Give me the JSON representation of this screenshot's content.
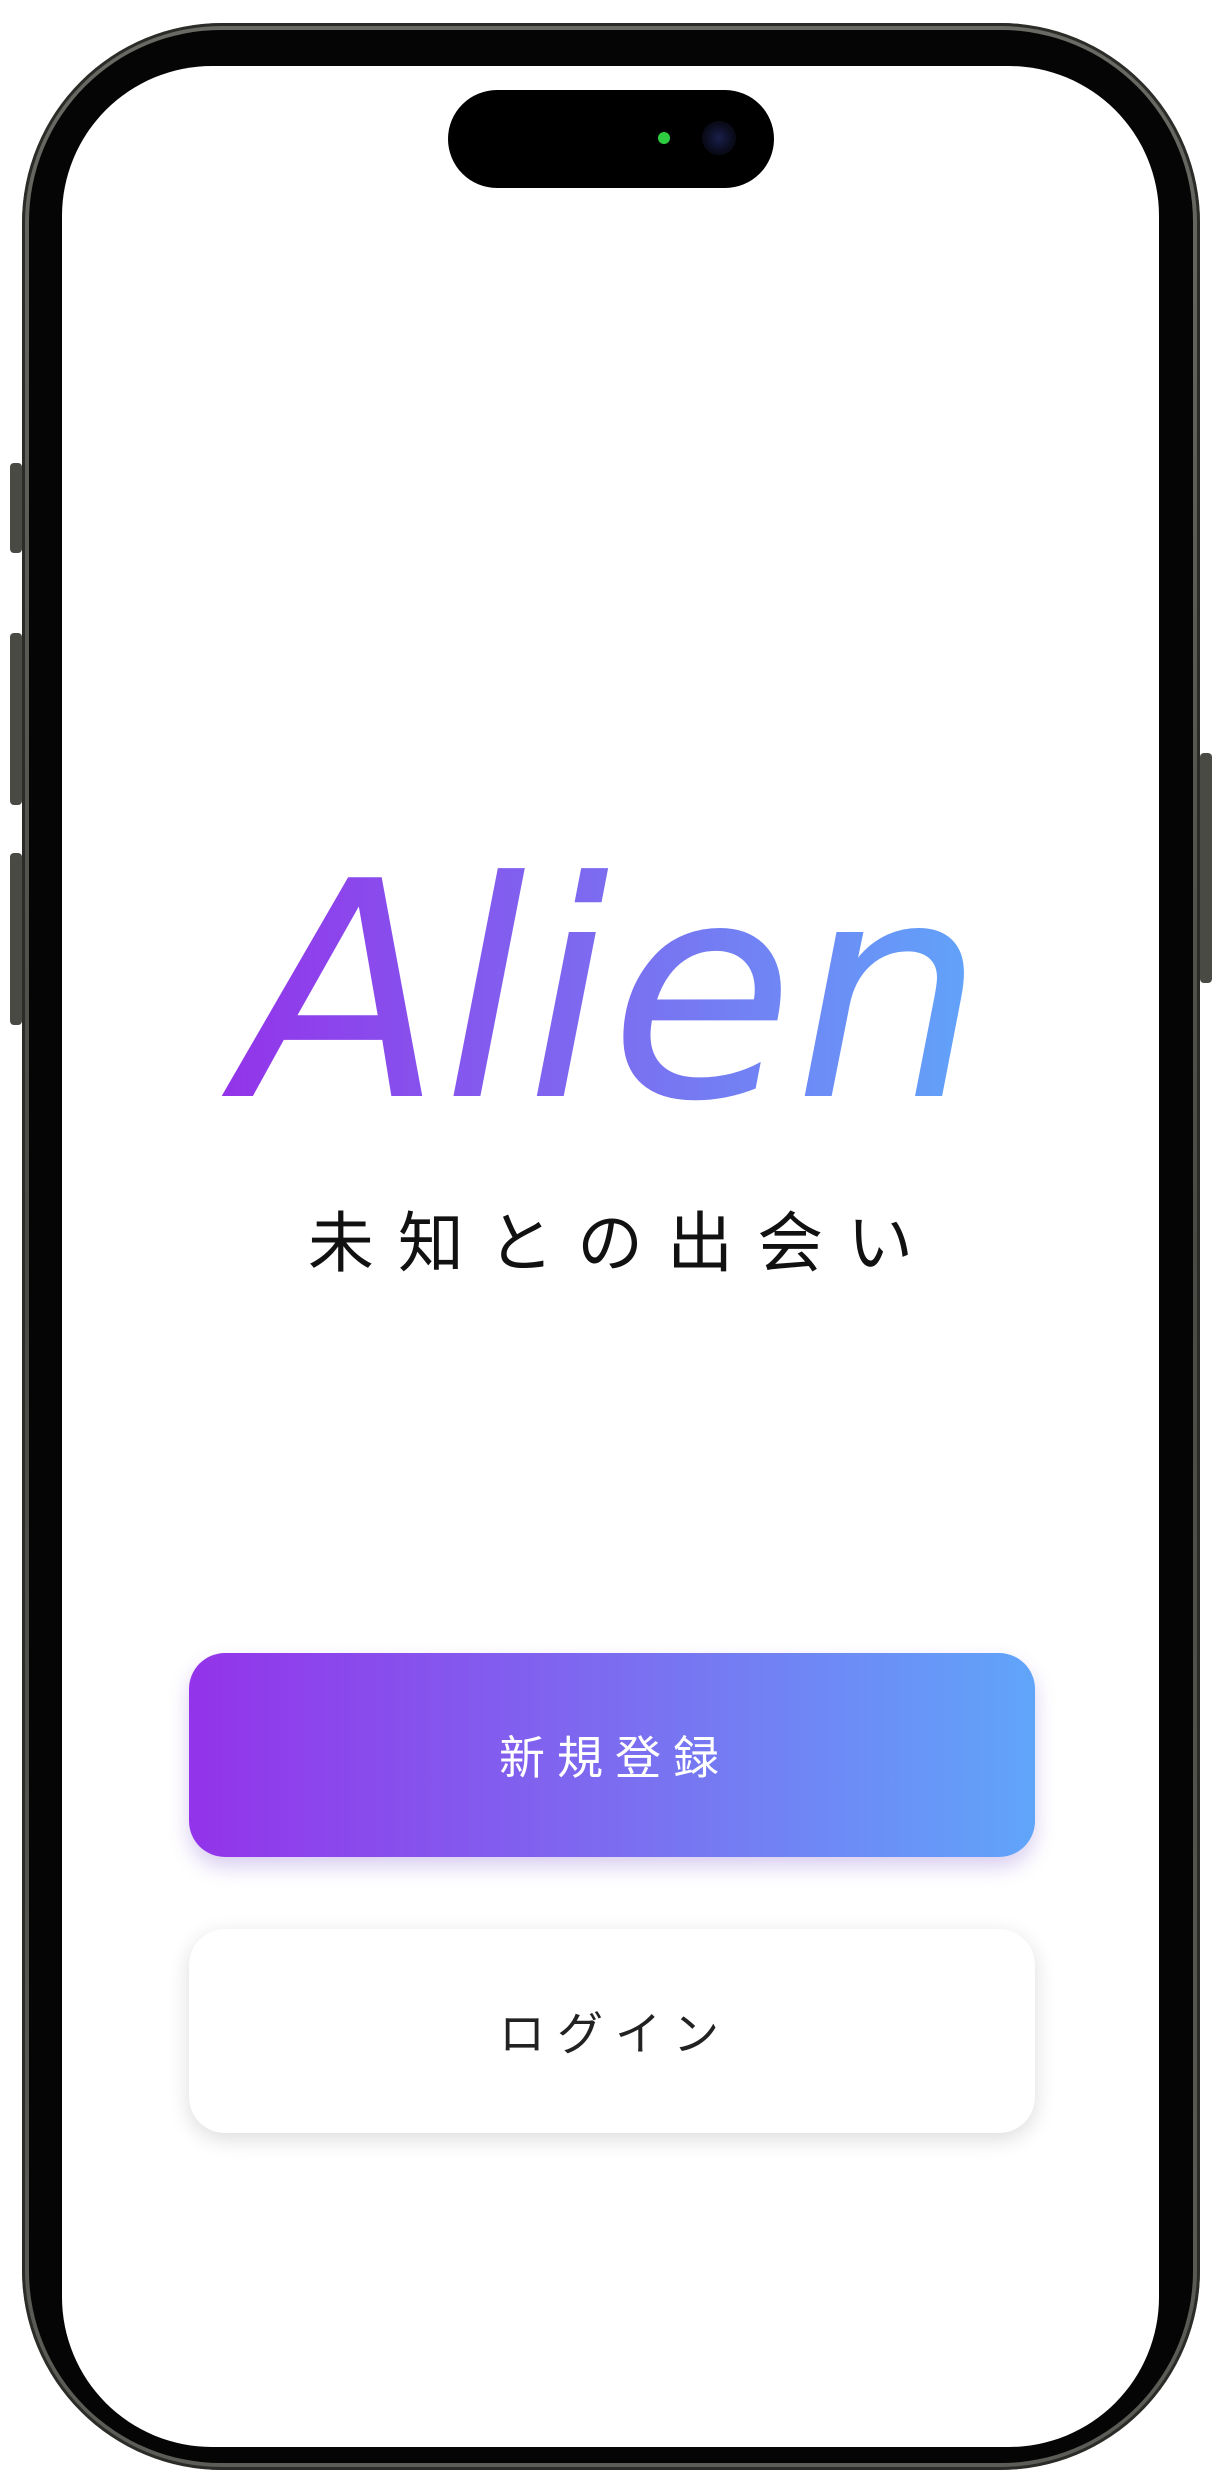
{
  "app": {
    "logo_text": "Alien",
    "tagline": "未知との出会い"
  },
  "buttons": {
    "signup_label": "新規登録",
    "login_label": "ログイン"
  },
  "colors": {
    "gradient_start": "#9333ea",
    "gradient_end": "#60a5fa",
    "background": "#ffffff",
    "text": "#111111"
  },
  "icons": {
    "front_camera": "front-camera-icon",
    "indicator": "camera-indicator-icon"
  }
}
